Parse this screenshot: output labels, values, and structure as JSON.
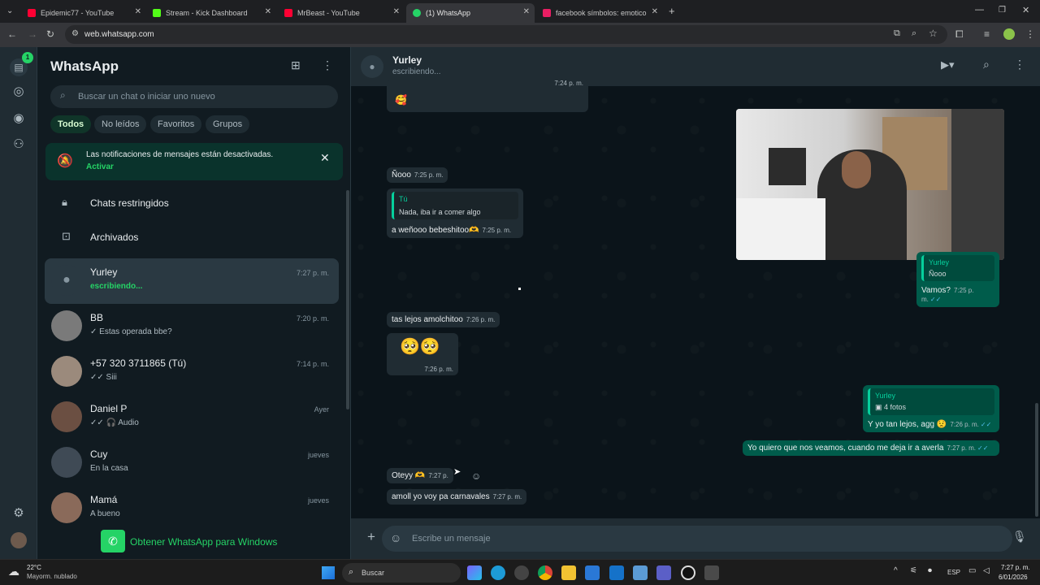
{
  "browser": {
    "tabs": [
      {
        "title": "Epidemic77 - YouTube",
        "color": "#ff0033"
      },
      {
        "title": "Stream - Kick Dashboard",
        "color": "#53fc18"
      },
      {
        "title": "MrBeast - YouTube",
        "color": "#ff0033"
      },
      {
        "title": "(1) WhatsApp",
        "color": "#25d366"
      },
      {
        "title": "facebook símbolos: emoticones",
        "color": "#e91e63"
      }
    ],
    "url": "web.whatsapp.com"
  },
  "rail": {
    "badge": "1"
  },
  "sidebar": {
    "title": "WhatsApp",
    "search_placeholder": "Buscar un chat o iniciar uno nuevo",
    "filters": [
      "Todos",
      "No leídos",
      "Favoritos",
      "Grupos"
    ],
    "notice": {
      "text": "Las notificaciones de mensajes están desactivadas.",
      "action": "Activar"
    },
    "restricted": "Chats restringidos",
    "archived": "Archivados",
    "chats": [
      {
        "name": "Yurley",
        "time": "7:27 p. m.",
        "preview": "escribiendo..."
      },
      {
        "name": "BB",
        "time": "7:20 p. m.",
        "preview": "✓ Estas operada bbe?"
      },
      {
        "name": "+57 320 3711865 (Tú)",
        "time": "7:14 p. m.",
        "preview": "✓✓ Siii"
      },
      {
        "name": "Daniel P",
        "time": "Ayer",
        "preview": "✓✓ 🎧 Audio"
      },
      {
        "name": "Cuy",
        "time": "jueves",
        "preview": "En la casa"
      },
      {
        "name": "Mamá",
        "time": "jueves",
        "preview": "A bueno"
      }
    ],
    "get_app": "Obtener WhatsApp para Windows"
  },
  "chat": {
    "contact": "Yurley",
    "status": "escribiendo...",
    "composer_placeholder": "Escribe un mensaje",
    "messages": {
      "m0_time": "7:24 p. m.",
      "m1_text": "Ñooo",
      "m1_time": "7:25 p. m.",
      "m2_quote_name": "Tú",
      "m2_quote_text": "Nada, iba ir a comer algo",
      "m2_text": "a weñooo bebeshitoo🫶",
      "m2_time": "7:25 p. m.",
      "m3_quote_name": "Yurley",
      "m3_quote_text": "Ñooo",
      "m3_text": "Vamos?",
      "m3_time": "7:25 p. m.",
      "m4_text": "tas lejos amolchitoo",
      "m4_time": "7:26 p. m.",
      "m5_emoji": "🥺🥺",
      "m5_time": "7:26 p. m.",
      "m6_quote_name": "Yurley",
      "m6_quote_text": "4 fotos",
      "m6_text": "Y yo tan lejos, agg 😟",
      "m6_time": "7:26 p. m.",
      "m7_text": "Yo quiero que nos veamos, cuando me deja ir a averla",
      "m7_time": "7:27 p. m.",
      "m8_text": "Oteyy 🫶",
      "m8_time": "7:27 p.",
      "m9_text": "amoll yo voy pa carnavales",
      "m9_time": "7:27 p. m."
    }
  },
  "taskbar": {
    "weather_temp": "22°C",
    "weather_desc": "Mayorm. nublado",
    "search": "Buscar",
    "lang": "ESP",
    "time": "7:27 p. m.",
    "date": "6/01/2026"
  }
}
